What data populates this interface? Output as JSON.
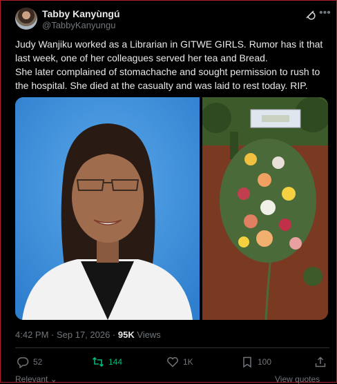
{
  "author": {
    "name": "Tabby Kanyùngú",
    "handle": "@TabbyKanyungu"
  },
  "tweet": {
    "text": "Judy Wanjiku worked as a Librarian in GITWE GIRLS. Rumor has it that last week, one of her colleagues served her tea and Bread.\nShe later complained of stomachache and sought permission to rush to the hospital. She died at the casualty and  was laid to rest today. RIP.",
    "timestamp": "4:42 PM · Sep 17, 2026 · ",
    "views_count": "95K",
    "views_label": " Views"
  },
  "actions": {
    "replies": "52",
    "retweets": "144",
    "likes": "1K",
    "bookmarks": "100"
  },
  "footer": {
    "left": "Relevant",
    "right": "View quotes"
  },
  "icons": {
    "header": [
      "grok-icon",
      "more-icon"
    ],
    "actions": [
      "reply-icon",
      "retweet-icon",
      "like-icon",
      "bookmark-icon",
      "share-icon"
    ]
  },
  "colors": {
    "background": "#000000",
    "text": "#e7e9ea",
    "muted": "#71767b",
    "retweet_active": "#00ba7c",
    "frame": "#b0202a"
  }
}
